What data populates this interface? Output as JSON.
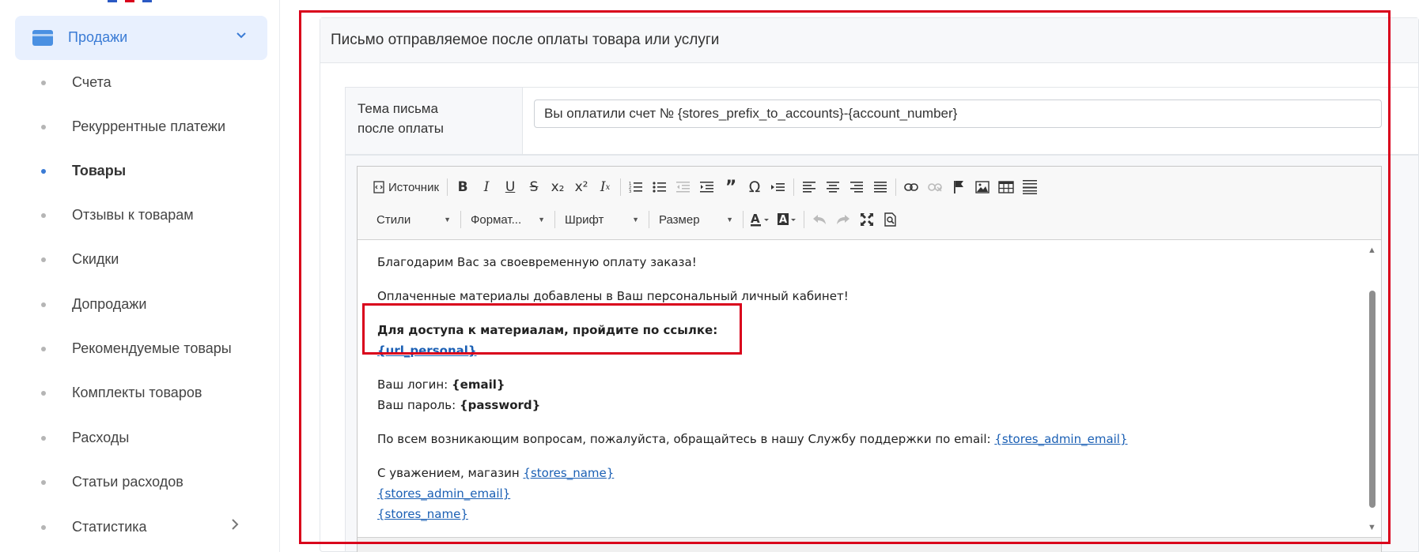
{
  "sidebar": {
    "colors": {
      "logo": [
        "#2b59c3",
        "#d9001b",
        "#2b59c3"
      ]
    },
    "header": {
      "icon": "card-icon",
      "label": "Продажи",
      "chevron": "chevron-down-icon",
      "color": "#3a7bd5"
    },
    "items": [
      {
        "label": "Счета",
        "active": false
      },
      {
        "label": "Рекуррентные платежи",
        "active": false
      },
      {
        "label": "Товары",
        "active": true
      },
      {
        "label": "Отзывы к товарам",
        "active": false
      },
      {
        "label": "Скидки",
        "active": false
      },
      {
        "label": "Допродажи",
        "active": false
      },
      {
        "label": "Рекомендуемые товары",
        "active": false
      },
      {
        "label": "Комплекты товаров",
        "active": false
      },
      {
        "label": "Расходы",
        "active": false
      },
      {
        "label": "Статьи расходов",
        "active": false
      },
      {
        "label": "Статистика",
        "active": false,
        "arrow": "chevron-right-icon"
      }
    ]
  },
  "panel": {
    "title": "Письмо отправляемое после оплаты товара или услуги",
    "subject_label_line1": "Тема письма",
    "subject_label_line2": "после оплаты",
    "subject_value": "Вы оплатили счет № {stores_prefix_to_accounts}-{account_number}"
  },
  "toolbar": {
    "source_label": "Источник",
    "styles_label": "Стили",
    "format_label": "Формат...",
    "font_label": "Шрифт",
    "size_label": "Размер"
  },
  "content": {
    "p1": "Благодарим Вас за своевременную оплату заказа!",
    "p2": "Оплаченные материалы добавлены в Ваш персональный личный кабинет!",
    "p3": "Для доступа к материалам, пройдите по ссылке:",
    "p3_link": "{url_personal}",
    "login_label": "Ваш логин: ",
    "login_value": "{email}",
    "password_label": "Ваш пароль: ",
    "password_value": "{password}",
    "support_text": "По всем возникающим вопросам, пожалуйста, обращайтесь в нашу Службу поддержки по email: ",
    "support_link": "{stores_admin_email}",
    "regards_text": "С уважением, магазин ",
    "regards_link": "{stores_name}",
    "sig_email": "{stores_admin_email}",
    "sig_name": "{stores_name}"
  },
  "highlight_color": "#d9001b"
}
